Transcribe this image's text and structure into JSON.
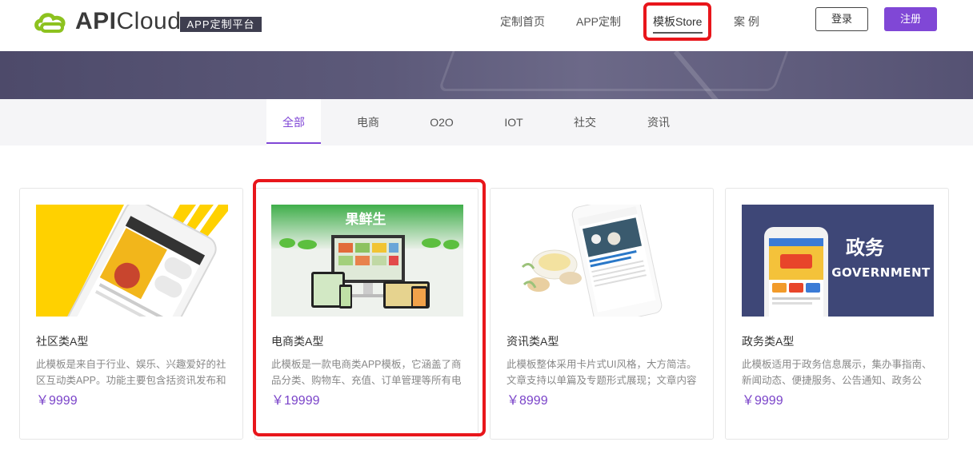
{
  "brand": {
    "name_api": "API",
    "name_cloud": "Cloud",
    "badge": "APP定制平台",
    "accent": "#8047d6"
  },
  "nav": {
    "items": [
      {
        "label": "定制首页"
      },
      {
        "label": "APP定制"
      },
      {
        "label": "模板Store"
      },
      {
        "label": "案 例"
      }
    ],
    "active_index": 2,
    "login": "登录",
    "register": "注册"
  },
  "tabs": {
    "items": [
      {
        "label": "全部"
      },
      {
        "label": "电商"
      },
      {
        "label": "O2O"
      },
      {
        "label": "IOT"
      },
      {
        "label": "社交"
      },
      {
        "label": "资讯"
      }
    ],
    "active_index": 0
  },
  "cards": [
    {
      "image_label": "",
      "title": "社区类A型",
      "desc": "此模板是来自于行业、娱乐、兴趣爱好的社区互动类APP。功能主要包含括资讯发布和",
      "price": "￥9999"
    },
    {
      "image_label": "果鲜生",
      "title": "电商类A型",
      "desc": "此模板是一款电商类APP模板，它涵盖了商品分类、购物车、充值、订单管理等所有电",
      "price": "￥19999"
    },
    {
      "image_label": "",
      "title": "资讯类A型",
      "desc": "此模板整体采用卡片式UI风格，大方简洁。文章支持以单篇及专题形式展现；文章内容",
      "price": "￥8999"
    },
    {
      "image_label_cn": "政务",
      "image_label_en": "GOVERNMENT",
      "title": "政务类A型",
      "desc": "此模板适用于政务信息展示，集办事指南、新闻动态、便捷服务、公告通知、政务公",
      "price": "￥9999"
    }
  ]
}
